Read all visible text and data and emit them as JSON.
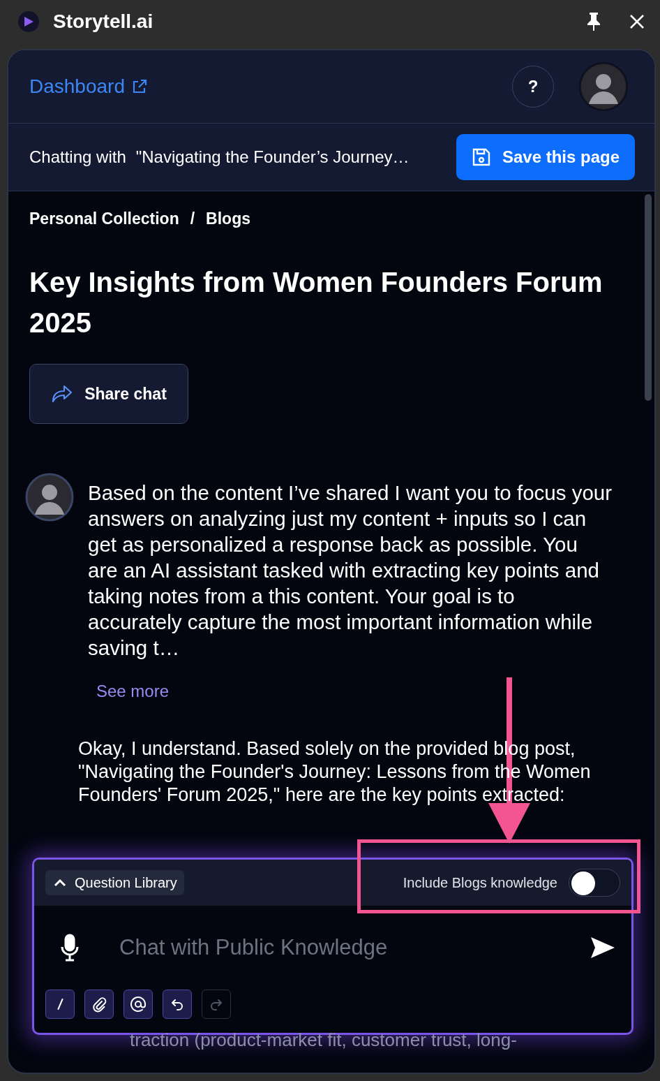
{
  "window": {
    "title": "Storytell.ai"
  },
  "header": {
    "dashboard_link": "Dashboard",
    "help_button": "?"
  },
  "chat_bar": {
    "prefix": "Chatting with",
    "document": "\"Navigating the Founder’s Journey…",
    "save_button": "Save this page"
  },
  "breadcrumb": {
    "items": [
      "Personal Collection",
      "Blogs"
    ],
    "separator": "/"
  },
  "title": "Key Insights from Women Founders Forum 2025",
  "share_button": "Share chat",
  "messages": [
    {
      "kind": "user",
      "text": "Based on the content I’ve shared I want you to focus your answers on analyzing just my content + inputs so I can get as personalized a response back as possible.  You are an AI assistant tasked with extracting key points and taking notes from a this content. Your goal is to accurately capture the most important information while saving t…",
      "see_more": "See more"
    },
    {
      "kind": "assistant",
      "text": "Okay, I understand. Based solely on the provided blog post, \"Navigating the Founder's Journey: Lessons from the Women Founders' Forum 2025,\" here are the key points extracted:"
    }
  ],
  "composer": {
    "question_library": "Question Library",
    "toggle_label": "Include Blogs knowledge",
    "toggle_on": false,
    "placeholder": "Chat with Public Knowledge",
    "tools": [
      {
        "kind": "slash",
        "disabled": false
      },
      {
        "kind": "attach",
        "disabled": false
      },
      {
        "kind": "mention",
        "disabled": false
      },
      {
        "kind": "undo",
        "disabled": false
      },
      {
        "kind": "redo",
        "disabled": true
      }
    ]
  },
  "trailing_text": "traction (product-market fit, customer trust, long-"
}
